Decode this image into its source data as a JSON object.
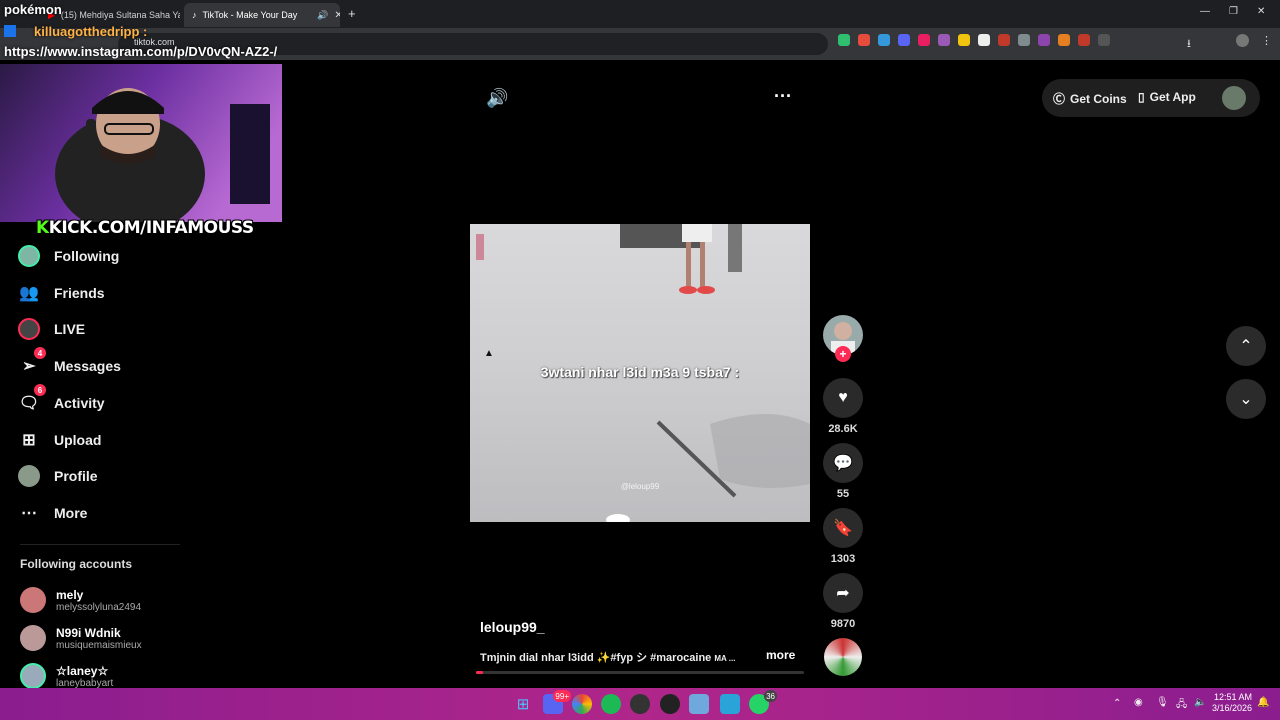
{
  "browser": {
    "tabs": [
      {
        "label": "(15) Mehdiya Sultana Saha Ya",
        "close": "✕"
      },
      {
        "label": "TikTok - Make Your Day",
        "close": "✕"
      }
    ],
    "new_tab": "+",
    "url": "tiktok.com"
  },
  "overlay": {
    "pokemon": "pokémon",
    "chatter": "killuagotthedripp :",
    "link": "https://www.instagram.com/p/DV0vQN-AZ2-/",
    "kick_k": "K",
    "kick_text": "KICK.COM/INFAMOUSS"
  },
  "sidebar": {
    "items": [
      {
        "label": "Following",
        "icon": "following-avatar-icon"
      },
      {
        "label": "Friends",
        "icon": "friends-icon"
      },
      {
        "label": "LIVE",
        "icon": "live-icon"
      },
      {
        "label": "Messages",
        "icon": "messages-icon",
        "badge": "4"
      },
      {
        "label": "Activity",
        "icon": "activity-icon",
        "badge": "6"
      },
      {
        "label": "Upload",
        "icon": "upload-icon"
      },
      {
        "label": "Profile",
        "icon": "profile-avatar-icon"
      },
      {
        "label": "More",
        "icon": "more-dots-icon"
      }
    ],
    "following_title": "Following accounts",
    "accounts": [
      {
        "name": "mely",
        "username": "melyssolyluna2494"
      },
      {
        "name": "N99i Wdnik",
        "username": "musiquemaismieux"
      },
      {
        "name": "☆laney☆",
        "username": "laneybabyart"
      }
    ]
  },
  "header": {
    "get_coins": "Get Coins",
    "get_app": "Get App"
  },
  "video": {
    "overlay_caption": "3wtani nhar l3id m3a 9 tsba7 :",
    "watermark": "@leloup99",
    "author": "leloup99_",
    "description": "Tmjnin dial nhar l3idd ✨#fyp シ #marocaine",
    "description_suffix": "MA ...",
    "more": "more",
    "progress": 0.02
  },
  "actions": {
    "likes": "28.6K",
    "comments": "55",
    "saves": "1303",
    "shares": "9870"
  },
  "taskbar": {
    "time": "12:51 AM",
    "date": "3/16/2026",
    "discord_badge": "99+",
    "whatsapp_badge": "36"
  },
  "colors": {
    "accent": "#fe2c55",
    "kick_green": "#53fc18",
    "taskbar": "#b0268a"
  }
}
